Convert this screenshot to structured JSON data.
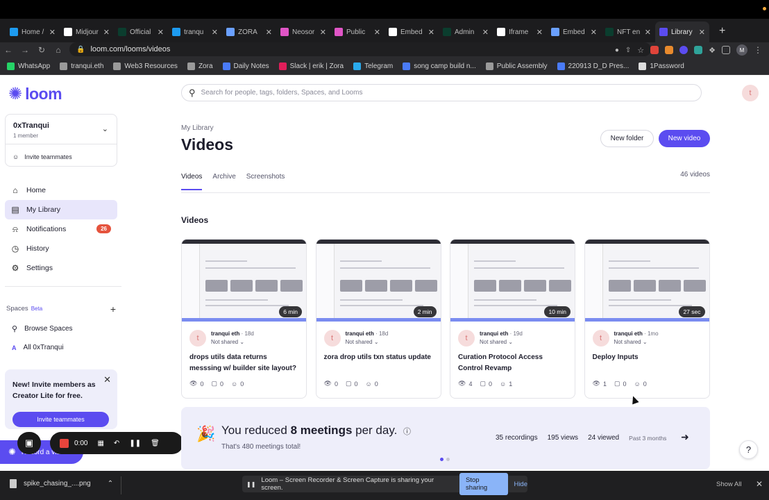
{
  "browser": {
    "tabs": [
      {
        "label": "Home /",
        "color": "#1d9bf0",
        "icon": "twitter-icon"
      },
      {
        "label": "Midjour",
        "color": "#ffffff",
        "icon": "midjourney-icon"
      },
      {
        "label": "Official",
        "color": "#0b3d2e",
        "icon": "page-icon"
      },
      {
        "label": "tranqu",
        "color": "#1d9bf0",
        "icon": "twitter-icon"
      },
      {
        "label": "ZORA",
        "color": "#6aa0ff",
        "icon": "zora-icon"
      },
      {
        "label": "Neosor",
        "color": "#e055c6",
        "icon": "page-icon"
      },
      {
        "label": "Public",
        "color": "#e055c6",
        "icon": "page-icon"
      },
      {
        "label": "Embed",
        "color": "#ffffff",
        "icon": "webflow-icon"
      },
      {
        "label": "Admin",
        "color": "#0b3d2e",
        "icon": "page-icon"
      },
      {
        "label": "Iframe",
        "color": "#ffffff",
        "icon": "webflow-icon"
      },
      {
        "label": "Embed",
        "color": "#6aa0ff",
        "icon": "zora-icon"
      },
      {
        "label": "NFT en",
        "color": "#0b3d2e",
        "icon": "page-icon"
      },
      {
        "label": "Library",
        "color": "#5b4cf0",
        "icon": "loom-icon",
        "active": true
      }
    ],
    "url": "loom.com/looms/videos",
    "bookmarks": [
      {
        "label": "WhatsApp",
        "color": "#25d366"
      },
      {
        "label": "tranqui.eth",
        "color": "#9a9a9a"
      },
      {
        "label": "Web3 Resources",
        "color": "#9a9a9a"
      },
      {
        "label": "Zora",
        "color": "#9a9a9a"
      },
      {
        "label": "Daily Notes",
        "color": "#4a7bf7"
      },
      {
        "label": "Slack | erik | Zora",
        "color": "#e01e5a"
      },
      {
        "label": "Telegram",
        "color": "#2aabee"
      },
      {
        "label": "song camp build n...",
        "color": "#4a7bf7"
      },
      {
        "label": "Public Assembly",
        "color": "#9a9a9a"
      },
      {
        "label": "220913 D_D Pres...",
        "color": "#4a7bf7"
      },
      {
        "label": "1Password",
        "color": "#dddddd"
      }
    ],
    "profile_initial": "M"
  },
  "sidebar": {
    "brand": "loom",
    "workspace": {
      "name": "0xTranqui",
      "members": "1 member",
      "invite": "Invite teammates"
    },
    "nav": [
      {
        "label": "Home",
        "icon": "home-icon"
      },
      {
        "label": "My Library",
        "icon": "library-icon",
        "active": true
      },
      {
        "label": "Notifications",
        "icon": "bell-icon",
        "badge": "26"
      },
      {
        "label": "History",
        "icon": "clock-icon"
      },
      {
        "label": "Settings",
        "icon": "gear-icon"
      }
    ],
    "spaces": {
      "title": "Spaces",
      "beta": "Beta",
      "browse": "Browse Spaces",
      "all": "All 0xTranqui",
      "all_initial": "A"
    },
    "promo": {
      "text": "New! Invite members as Creator Lite for free.",
      "button": "Invite teammates"
    },
    "record": {
      "label": "Record a video",
      "timer": "0:00"
    }
  },
  "main": {
    "search_placeholder": "Search for people, tags, folders, Spaces, and Looms",
    "user_initial": "t",
    "breadcrumb": "My Library",
    "title": "Videos",
    "new_folder": "New folder",
    "new_video": "New video",
    "tabs": [
      "Videos",
      "Archive",
      "Screenshots"
    ],
    "video_count": "46 videos",
    "section_title": "Videos",
    "videos": [
      {
        "author": "tranqui eth",
        "age": "18d",
        "share": "Not shared",
        "duration": "6 min",
        "title": "drops utils data returns messsing w/ builder site layout?",
        "views": "0",
        "comments": "0",
        "reactions": "0"
      },
      {
        "author": "tranqui eth",
        "age": "18d",
        "share": "Not shared",
        "duration": "2 min",
        "title": "zora drop utils txn status update",
        "views": "0",
        "comments": "0",
        "reactions": "0"
      },
      {
        "author": "tranqui eth",
        "age": "19d",
        "share": "Not shared",
        "duration": "10 min",
        "title": "Curation Protocol Access Control Revamp",
        "views": "4",
        "comments": "0",
        "reactions": "1"
      },
      {
        "author": "tranqui eth",
        "age": "1mo",
        "share": "Not shared",
        "duration": "27 sec",
        "title": "Deploy Inputs",
        "views": "1",
        "comments": "0",
        "reactions": "0"
      }
    ],
    "banner": {
      "prefix": "You reduced",
      "highlight": "8 meetings",
      "suffix": "per day.",
      "sub": "That's 480 meetings total!",
      "recordings": "35 recordings",
      "views": "195 views",
      "viewed": "24 viewed",
      "period": "Past 3 months"
    },
    "help": "?"
  },
  "bottom": {
    "download_file": "spike_chasing_....png",
    "share_text": "Loom – Screen Recorder & Screen Capture is sharing your screen.",
    "stop_sharing": "Stop sharing",
    "hide": "Hide",
    "show_all": "Show All"
  },
  "colors": {
    "accent": "#5b4cf0",
    "badge": "#e5533d"
  }
}
